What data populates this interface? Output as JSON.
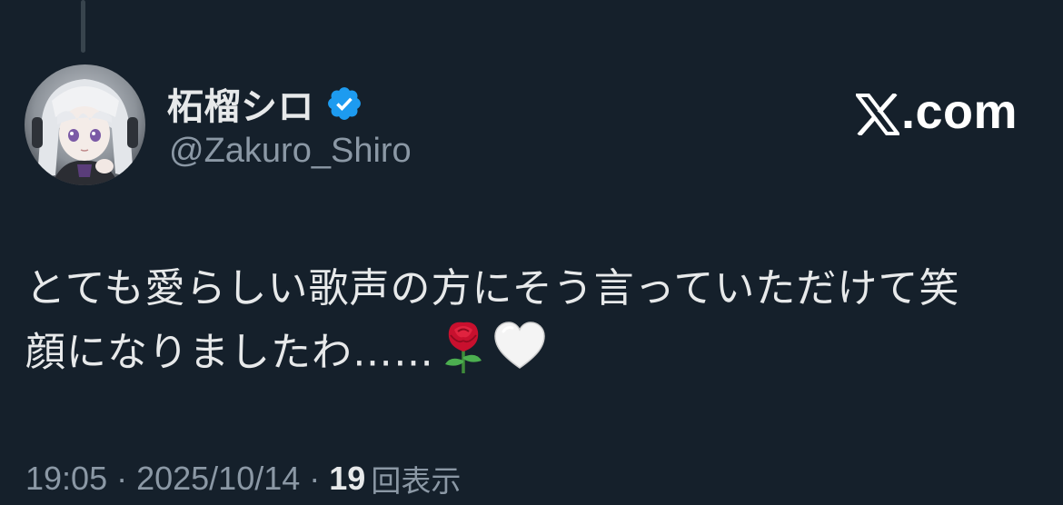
{
  "tweet": {
    "author": {
      "display_name": "柘榴シロ",
      "handle": "@Zakuro_Shiro",
      "verified": true
    },
    "site": {
      "logo_icon": "x-logo-icon",
      "domain_suffix": ".com"
    },
    "text_line_1": "とても愛らしい歌声の方にそう言っていただけて笑",
    "text_line_2": "顔になりましたわ……",
    "emojis": [
      "rose-emoji",
      "white-heart-emoji"
    ],
    "meta": {
      "time": "19:05",
      "date": "2025/10/14",
      "separator": "·",
      "views_count": "19",
      "views_label": "回表示"
    }
  },
  "colors": {
    "background": "#15202b",
    "primary_text": "#e7e9ea",
    "secondary_text": "#8b98a5",
    "verified_blue": "#1d9bf0",
    "thread_line": "#38444d"
  }
}
